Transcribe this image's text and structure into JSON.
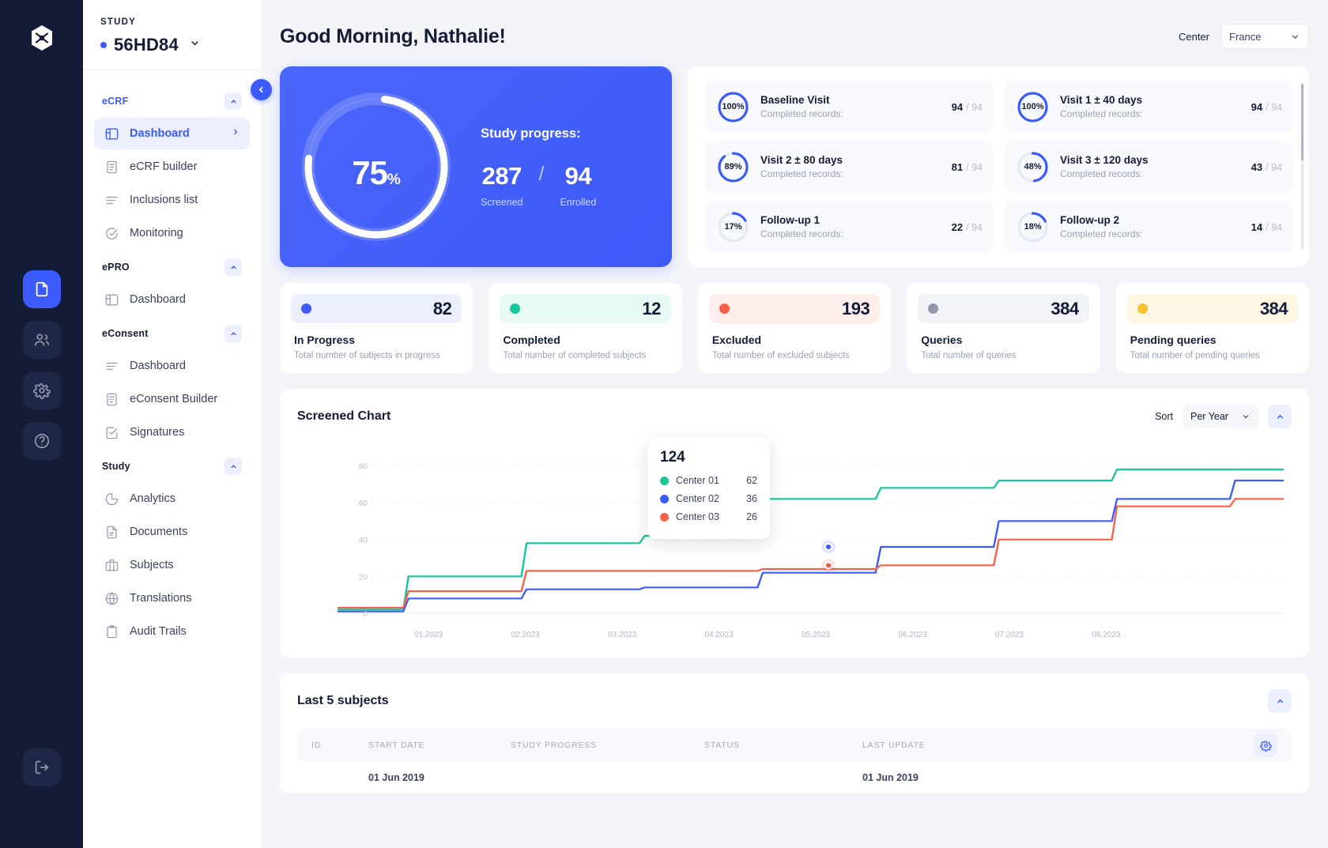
{
  "rail": {
    "logo": "logo-mark",
    "buttons": [
      {
        "name": "documents",
        "icon": "document-icon",
        "active": true
      },
      {
        "name": "users",
        "icon": "users-icon",
        "active": false
      },
      {
        "name": "settings",
        "icon": "gear-icon",
        "active": false
      },
      {
        "name": "help",
        "icon": "help-circle-icon",
        "active": false
      }
    ],
    "logout_icon": "logout-icon"
  },
  "sidebar": {
    "study_label": "STUDY",
    "study_name": "56HD84",
    "sections": [
      {
        "title": "eCRF",
        "accent": true,
        "items": [
          {
            "label": "Dashboard",
            "icon": "layout-icon",
            "active": true
          },
          {
            "label": "eCRF builder",
            "icon": "form-icon",
            "active": false
          },
          {
            "label": "Inclusions list",
            "icon": "list-icon",
            "active": false
          },
          {
            "label": "Monitoring",
            "icon": "check-circle-icon",
            "active": false
          }
        ]
      },
      {
        "title": "ePRO",
        "accent": false,
        "items": [
          {
            "label": "Dashboard",
            "icon": "layout-icon",
            "active": false
          }
        ]
      },
      {
        "title": "eConsent",
        "accent": false,
        "items": [
          {
            "label": "Dashboard",
            "icon": "list-icon",
            "active": false
          },
          {
            "label": "eConsent Builder",
            "icon": "form-icon",
            "active": false
          },
          {
            "label": "Signatures",
            "icon": "check-square-icon",
            "active": false
          }
        ]
      },
      {
        "title": "Study",
        "accent": false,
        "items": [
          {
            "label": "Analytics",
            "icon": "pie-chart-icon",
            "active": false
          },
          {
            "label": "Documents",
            "icon": "document-icon",
            "active": false
          },
          {
            "label": "Subjects",
            "icon": "briefcase-icon",
            "active": false
          },
          {
            "label": "Translations",
            "icon": "globe-icon",
            "active": false
          },
          {
            "label": "Audit Trails",
            "icon": "clipboard-icon",
            "active": false
          }
        ]
      }
    ]
  },
  "header": {
    "greeting": "Good Morning, Nathalie!",
    "center_label": "Center",
    "center_value": "France"
  },
  "progress": {
    "percent": "75",
    "percent_symbol": "%",
    "title": "Study progress:",
    "screened_value": "287",
    "screened_label": "Screened",
    "separator": "/",
    "enrolled_value": "94",
    "enrolled_label": "Enrolled",
    "percent_number": 75
  },
  "visits": [
    {
      "percent": "100%",
      "pct": 100,
      "name": "Baseline Visit",
      "sub": "Completed records:",
      "done": "94",
      "total": "94"
    },
    {
      "percent": "100%",
      "pct": 100,
      "name": "Visit 1 ± 40 days",
      "sub": "Completed records:",
      "done": "94",
      "total": "94"
    },
    {
      "percent": "89%",
      "pct": 89,
      "name": "Visit 2 ± 80 days",
      "sub": "Completed records:",
      "done": "81",
      "total": "94"
    },
    {
      "percent": "48%",
      "pct": 48,
      "name": "Visit 3 ± 120 days",
      "sub": "Completed records:",
      "done": "43",
      "total": "94"
    },
    {
      "percent": "17%",
      "pct": 17,
      "name": "Follow-up 1",
      "sub": "Completed records:",
      "done": "22",
      "total": "94"
    },
    {
      "percent": "18%",
      "pct": 18,
      "name": "Follow-up 2",
      "sub": "Completed records:",
      "done": "14",
      "total": "94"
    }
  ],
  "stats": [
    {
      "value": "82",
      "name": "In Progress",
      "desc": "Total number of subjects in progress",
      "color": "#3b5bfd",
      "bg": "#eceffe"
    },
    {
      "value": "12",
      "name": "Completed",
      "desc": "Total number of completed subjects",
      "color": "#16c79a",
      "bg": "#e7f9f3"
    },
    {
      "value": "193",
      "name": "Excluded",
      "desc": "Total number of excluded subjects",
      "color": "#f9604a",
      "bg": "#fdeeec"
    },
    {
      "value": "384",
      "name": "Queries",
      "desc": "Total number of queries",
      "color": "#9198ad",
      "bg": "#f2f3f7"
    },
    {
      "value": "384",
      "name": "Pending queries",
      "desc": "Total number of pending queries",
      "color": "#fbc02d",
      "bg": "#fdf6e3"
    }
  ],
  "chart": {
    "title": "Screened Chart",
    "sort_label": "Sort",
    "sort_value": "Per Year",
    "collapse_icon": "chevron-up-icon",
    "tooltip": {
      "total": "124",
      "rows": [
        {
          "name": "Center 01",
          "value": "62",
          "color": "#16c79a"
        },
        {
          "name": "Center 02",
          "value": "36",
          "color": "#3b5bfd"
        },
        {
          "name": "Center 03",
          "value": "26",
          "color": "#f9604a"
        }
      ]
    }
  },
  "chart_data": {
    "type": "line",
    "title": "Screened Chart",
    "xlabel": "",
    "ylabel": "",
    "x": [
      "01.2023",
      "02.2023",
      "03.2023",
      "04.2023",
      "05.2023",
      "06.2023",
      "07.2023",
      "08.2023"
    ],
    "ylim": [
      0,
      90
    ],
    "yticks": [
      0,
      20,
      40,
      60,
      80
    ],
    "grid": false,
    "legend": "tooltip",
    "series": [
      {
        "name": "Center 01",
        "color": "#16c79a",
        "values": [
          2,
          20,
          38,
          42,
          62,
          68,
          72,
          78,
          78
        ]
      },
      {
        "name": "Center 02",
        "color": "#3b5bfd",
        "values": [
          1,
          8,
          13,
          14,
          22,
          36,
          50,
          62,
          72
        ]
      },
      {
        "name": "Center 03",
        "color": "#f9604a",
        "values": [
          3,
          12,
          23,
          23,
          24,
          26,
          40,
          58,
          62
        ]
      }
    ]
  },
  "table": {
    "title": "Last 5 subjects",
    "collapse_icon": "chevron-up-icon",
    "gear_icon": "gear-icon",
    "columns": [
      "ID",
      "START DATE",
      "STUDY PROGRESS",
      "STATUS",
      "LAST UPDATE"
    ],
    "rows": [
      {
        "id": "",
        "start_date": "01 Jun 2019",
        "progress": "",
        "status": "",
        "last_update": "01 Jun 2019"
      }
    ]
  }
}
